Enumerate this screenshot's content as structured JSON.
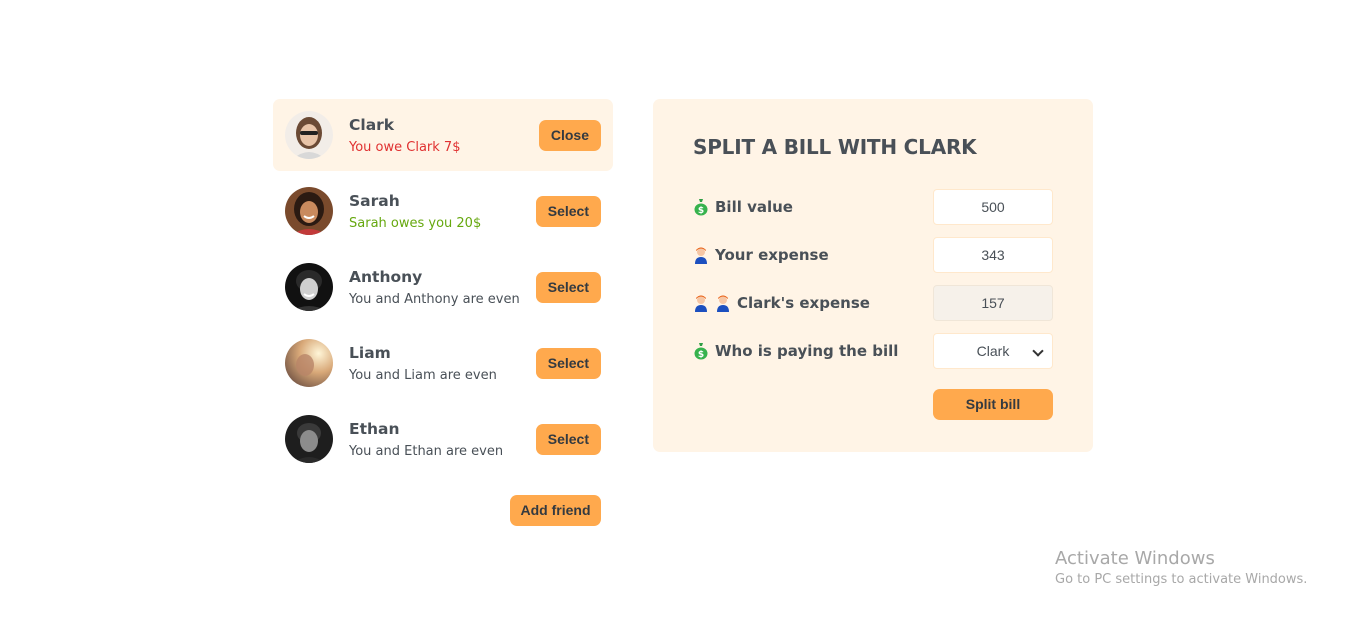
{
  "friends": [
    {
      "name": "Clark",
      "status": "You owe Clark 7$",
      "status_tone": "owe",
      "button": "Close",
      "selected": true
    },
    {
      "name": "Sarah",
      "status": "Sarah owes you 20$",
      "status_tone": "owed",
      "button": "Select",
      "selected": false
    },
    {
      "name": "Anthony",
      "status": "You and Anthony are even",
      "status_tone": "even",
      "button": "Select",
      "selected": false
    },
    {
      "name": "Liam",
      "status": "You and Liam are even",
      "status_tone": "even",
      "button": "Select",
      "selected": false
    },
    {
      "name": "Ethan",
      "status": "You and Ethan are even",
      "status_tone": "even",
      "button": "Select",
      "selected": false
    }
  ],
  "add_friend_label": "Add friend",
  "split_form": {
    "title": "SPLIT A BILL WITH CLARK",
    "bill_value": {
      "label": "Bill value",
      "icon": "money-bag-icon",
      "value": "500"
    },
    "your_expense": {
      "label": "Your expense",
      "icon": "person-icon",
      "value": "343"
    },
    "friend_expense": {
      "label": "Clark's expense",
      "icon": "two-people-icon",
      "value": "157"
    },
    "payer": {
      "label": "Who is paying the bill",
      "icon": "money-bag-icon",
      "selected": "Clark"
    },
    "submit_label": "Split bill"
  },
  "watermark": {
    "title": "Activate Windows",
    "subtitle": "Go to PC settings to activate Windows."
  },
  "colors": {
    "accent": "#ffa94d",
    "panel_bg": "#fff4e6",
    "owe": "#e03131",
    "owed": "#66a80f",
    "text": "#495057"
  }
}
